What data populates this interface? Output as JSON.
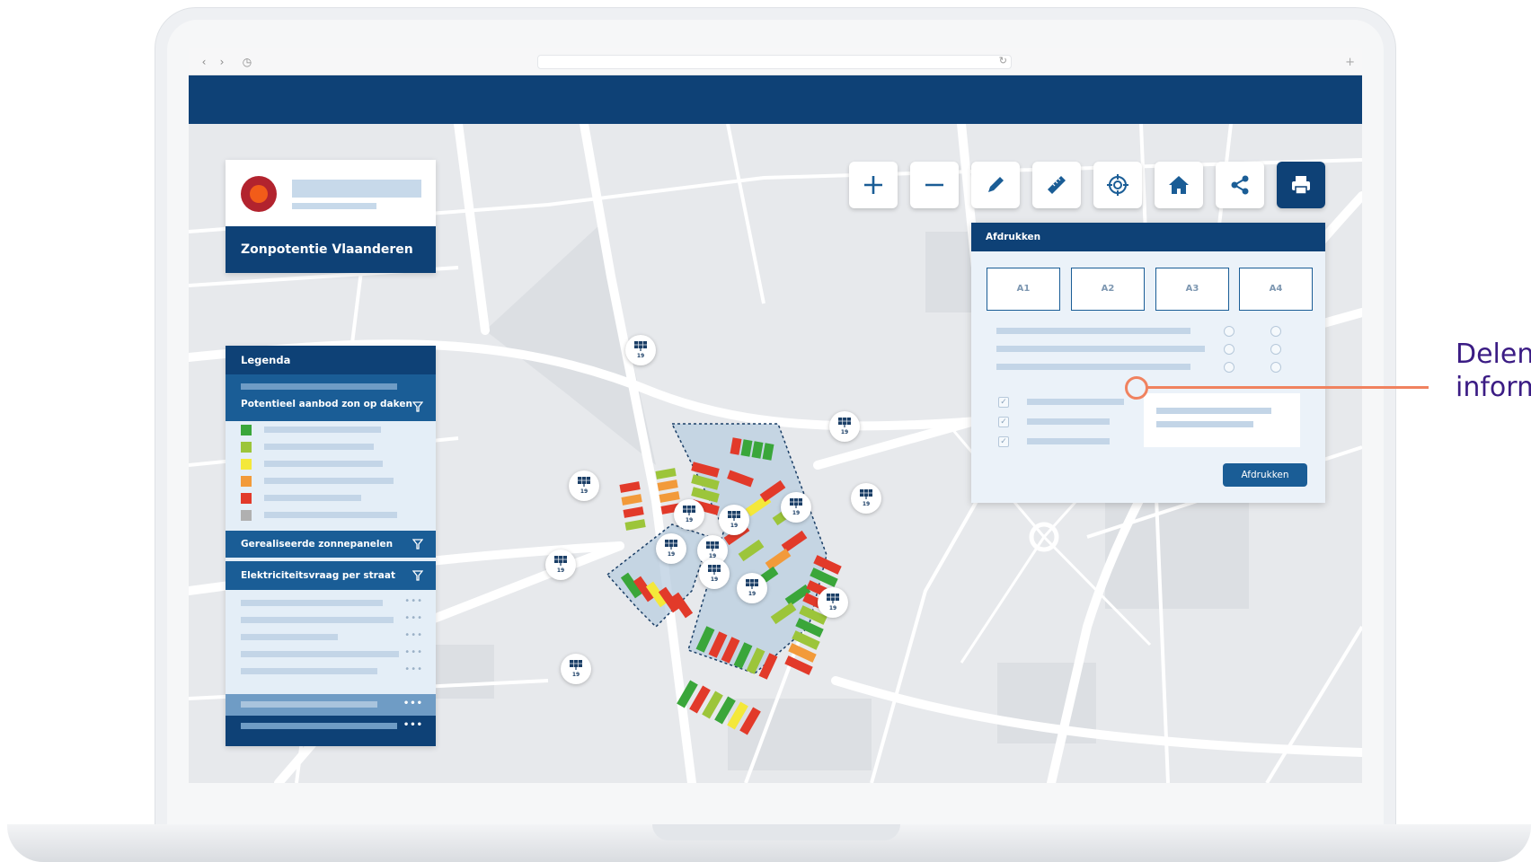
{
  "browser": {
    "back_icon": "chevron-left-icon",
    "forward_icon": "chevron-right-icon",
    "history_icon": "clock-icon",
    "reload_icon": "reload-icon",
    "newtab_icon": "plus-icon"
  },
  "app": {
    "title": "Zonpotentie Vlaanderen",
    "header_color": "#0e4176"
  },
  "legend": {
    "title": "Legenda",
    "sections": [
      {
        "label": "Potentieel aanbod zon op daken",
        "icon": "filter-icon"
      },
      {
        "label": "Gerealiseerde zonnepanelen",
        "icon": "filter-icon"
      },
      {
        "label": "Elektriciteitsvraag per straat",
        "icon": "filter-icon"
      }
    ],
    "swatches": [
      "#3aa63a",
      "#9cc53a",
      "#f4e83a",
      "#f29a3a",
      "#e23a2a",
      "#b0b0b0"
    ]
  },
  "toolbar": {
    "tools": [
      {
        "name": "zoom-in",
        "icon": "plus-icon"
      },
      {
        "name": "zoom-out",
        "icon": "minus-icon"
      },
      {
        "name": "draw",
        "icon": "pencil-icon"
      },
      {
        "name": "measure",
        "icon": "ruler-icon"
      },
      {
        "name": "locate",
        "icon": "crosshair-icon"
      },
      {
        "name": "home",
        "icon": "home-icon"
      },
      {
        "name": "share",
        "icon": "share-icon"
      },
      {
        "name": "print",
        "icon": "printer-icon",
        "active": true
      }
    ]
  },
  "print_panel": {
    "title": "Afdrukken",
    "formats": [
      "A1",
      "A2",
      "A3",
      "A4"
    ],
    "button_label": "Afdrukken"
  },
  "map": {
    "marker_count": "19",
    "marker_icon": "solar-panel-icon"
  },
  "callout": {
    "line1": "Delen",
    "line2": "inform"
  },
  "colors": {
    "accent": "#0e4176",
    "accent_light": "#1a5d96",
    "callout": "#f0825f",
    "callout_text": "#3b1c84"
  }
}
